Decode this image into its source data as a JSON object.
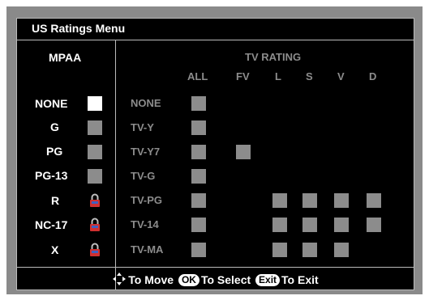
{
  "title": "US Ratings Menu",
  "mpaa": {
    "header": "MPAA",
    "items": [
      {
        "label": "NONE",
        "state": "selected"
      },
      {
        "label": "G",
        "state": "unlocked"
      },
      {
        "label": "PG",
        "state": "unlocked"
      },
      {
        "label": "PG-13",
        "state": "unlocked"
      },
      {
        "label": "R",
        "state": "locked"
      },
      {
        "label": "NC-17",
        "state": "locked"
      },
      {
        "label": "X",
        "state": "locked"
      }
    ]
  },
  "tv": {
    "header": "TV RATING",
    "columns": [
      "ALL",
      "FV",
      "L",
      "S",
      "V",
      "D"
    ],
    "rows": [
      {
        "label": "NONE"
      },
      {
        "label": "TV-Y"
      },
      {
        "label": "TV-Y7"
      },
      {
        "label": "TV-G"
      },
      {
        "label": "TV-PG"
      },
      {
        "label": "TV-14"
      },
      {
        "label": "TV-MA"
      }
    ]
  },
  "footer": {
    "move": "To Move",
    "ok": "OK",
    "select": "To Select",
    "exit_key": "Exit",
    "exit": "To Exit"
  },
  "colors": {
    "panel": "#000000",
    "frame": "#8a8a8a",
    "inactive": "#8c8c8c",
    "lock": "#d03030"
  }
}
